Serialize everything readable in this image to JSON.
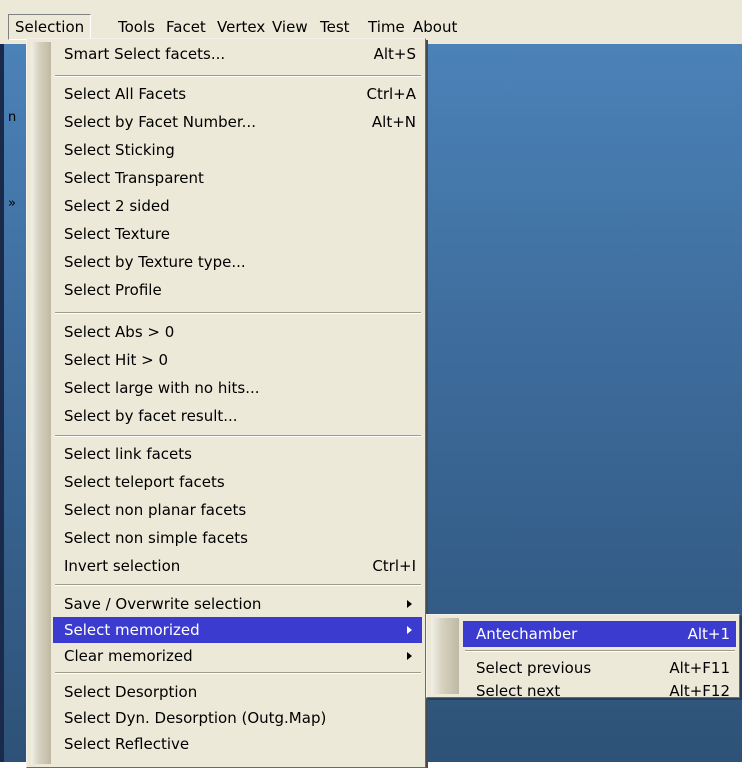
{
  "menubar": {
    "items": [
      "Selection",
      "Tools",
      "Facet",
      "Vertex",
      "View",
      "Test",
      "Time",
      "About"
    ],
    "active": "Selection"
  },
  "desktop": {
    "side_glyphs": [
      "n",
      "»"
    ]
  },
  "menu": {
    "items": [
      {
        "label": "Smart Select facets...",
        "shortcut": "Alt+S"
      },
      {
        "label": "Select All Facets",
        "shortcut": "Ctrl+A"
      },
      {
        "label": "Select by Facet Number...",
        "shortcut": "Alt+N"
      },
      {
        "label": "Select Sticking",
        "shortcut": ""
      },
      {
        "label": "Select Transparent",
        "shortcut": ""
      },
      {
        "label": "Select 2 sided",
        "shortcut": ""
      },
      {
        "label": "Select Texture",
        "shortcut": ""
      },
      {
        "label": "Select by Texture type...",
        "shortcut": ""
      },
      {
        "label": "Select Profile",
        "shortcut": ""
      },
      {
        "label": "Select Abs > 0",
        "shortcut": ""
      },
      {
        "label": "Select Hit > 0",
        "shortcut": ""
      },
      {
        "label": "Select large with no hits...",
        "shortcut": ""
      },
      {
        "label": "Select by facet result...",
        "shortcut": ""
      },
      {
        "label": "Select link facets",
        "shortcut": ""
      },
      {
        "label": "Select teleport facets",
        "shortcut": ""
      },
      {
        "label": "Select non planar facets",
        "shortcut": ""
      },
      {
        "label": "Select non simple facets",
        "shortcut": ""
      },
      {
        "label": "Invert selection",
        "shortcut": "Ctrl+I"
      },
      {
        "label": "Save / Overwrite selection",
        "shortcut": ""
      },
      {
        "label": "Select memorized",
        "shortcut": ""
      },
      {
        "label": "Clear memorized",
        "shortcut": ""
      },
      {
        "label": "Select Desorption",
        "shortcut": ""
      },
      {
        "label": "Select Dyn. Desorption (Outg.Map)",
        "shortcut": ""
      },
      {
        "label": "Select Reflective",
        "shortcut": ""
      }
    ]
  },
  "submenu": {
    "items": [
      {
        "label": "Antechamber",
        "shortcut": "Alt+1"
      },
      {
        "label": "Select previous",
        "shortcut": "Alt+F11"
      },
      {
        "label": "Select next",
        "shortcut": "Alt+F12"
      }
    ]
  }
}
